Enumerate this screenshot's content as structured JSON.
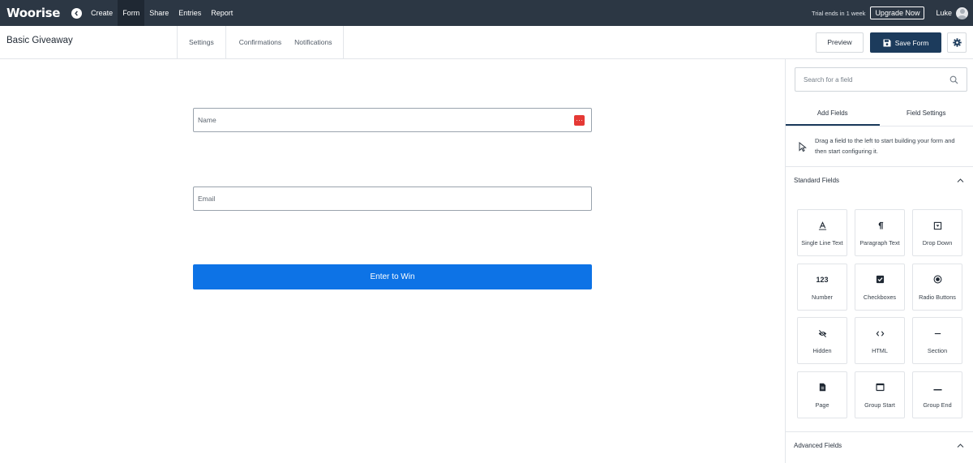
{
  "topbar": {
    "logo": "Woorise",
    "nav": [
      "Create",
      "Form",
      "Share",
      "Entries",
      "Report"
    ],
    "active_nav": "Form",
    "trial_text": "Trial ends in 1 week",
    "upgrade_label": "Upgrade Now",
    "user_name": "Luke"
  },
  "subbar": {
    "form_title": "Basic Giveaway",
    "tabs": [
      "Settings",
      "Confirmations",
      "Notifications"
    ],
    "preview_label": "Preview",
    "save_label": "Save Form"
  },
  "form": {
    "name_placeholder": "Name",
    "email_placeholder": "Email",
    "submit_label": "Enter to Win"
  },
  "panel": {
    "search_placeholder": "Search for a field",
    "tabs": [
      "Add Fields",
      "Field Settings"
    ],
    "active_tab": "Add Fields",
    "hint": "Drag a field to the left to start building your form and then start configuring it.",
    "standard_title": "Standard Fields",
    "advanced_title": "Advanced Fields",
    "fields": [
      {
        "label": "Single Line Text",
        "icon": "text-a-icon"
      },
      {
        "label": "Paragraph Text",
        "icon": "pilcrow-icon"
      },
      {
        "label": "Drop Down",
        "icon": "dropdown-icon"
      },
      {
        "label": "Number",
        "icon": "number-icon",
        "glyph": "123"
      },
      {
        "label": "Checkboxes",
        "icon": "checkbox-icon"
      },
      {
        "label": "Radio Buttons",
        "icon": "radio-icon"
      },
      {
        "label": "Hidden",
        "icon": "eye-off-icon"
      },
      {
        "label": "HTML",
        "icon": "code-icon"
      },
      {
        "label": "Section",
        "icon": "section-line-icon"
      },
      {
        "label": "Page",
        "icon": "page-icon"
      },
      {
        "label": "Group Start",
        "icon": "group-start-icon"
      },
      {
        "label": "Group End",
        "icon": "group-end-icon"
      }
    ]
  },
  "colors": {
    "topbar": "#2c3744",
    "save_button": "#1c3b5c",
    "submit_button": "#0d73e6",
    "field_action": "#e53935"
  }
}
